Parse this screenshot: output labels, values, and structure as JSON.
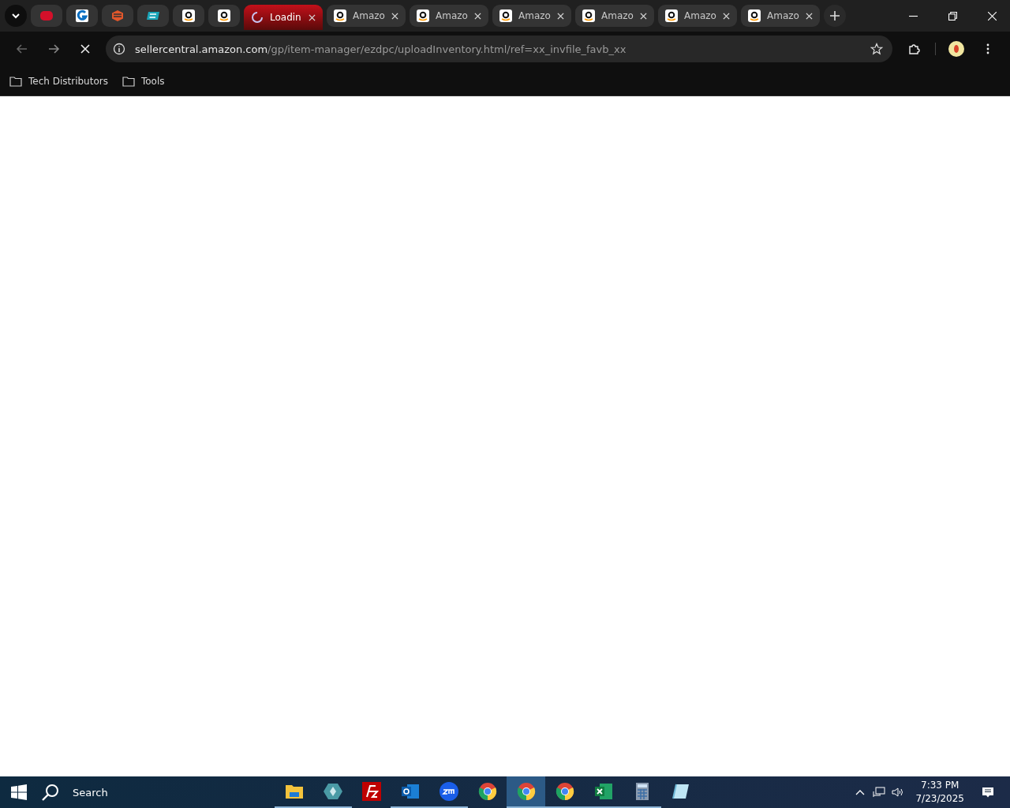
{
  "tabs": [
    {
      "kind": "pinned",
      "selected": false
    },
    {
      "kind": "pinned",
      "selected": false
    },
    {
      "kind": "pinned",
      "selected": false
    },
    {
      "kind": "pinned",
      "selected": false
    },
    {
      "kind": "pinned",
      "selected": false
    },
    {
      "kind": "pinned",
      "selected": false
    },
    {
      "kind": "loading",
      "title": "Loadin",
      "selected": true
    },
    {
      "kind": "page",
      "title": "Amazo",
      "selected": false
    },
    {
      "kind": "page",
      "title": "Amazo",
      "selected": false
    },
    {
      "kind": "page",
      "title": "Amazo",
      "selected": false
    },
    {
      "kind": "page",
      "title": "Amazo",
      "selected": false
    },
    {
      "kind": "page",
      "title": "Amazo",
      "selected": false
    },
    {
      "kind": "page",
      "title": "Amazo",
      "selected": false
    }
  ],
  "address_bar": {
    "host": "sellercentral.amazon.com",
    "path": "/gp/item-manager/ezdpc/uploadInventory.html/ref=xx_invfile_favb_xx"
  },
  "bookmarks": [
    "Tech Distributors",
    "Tools"
  ],
  "taskbar": {
    "search": "Search",
    "apps": [
      {
        "running": true,
        "selected": false
      },
      {
        "running": true,
        "selected": false
      },
      {
        "running": false,
        "selected": false
      },
      {
        "running": true,
        "selected": false
      },
      {
        "running": true,
        "selected": false
      },
      {
        "running": false,
        "selected": false
      },
      {
        "running": true,
        "selected": true
      },
      {
        "running": true,
        "selected": false
      },
      {
        "running": true,
        "selected": false
      },
      {
        "running": true,
        "selected": false
      },
      {
        "running": false,
        "selected": false
      }
    ],
    "time": "7:33 PM",
    "date": "7/23/2025"
  }
}
